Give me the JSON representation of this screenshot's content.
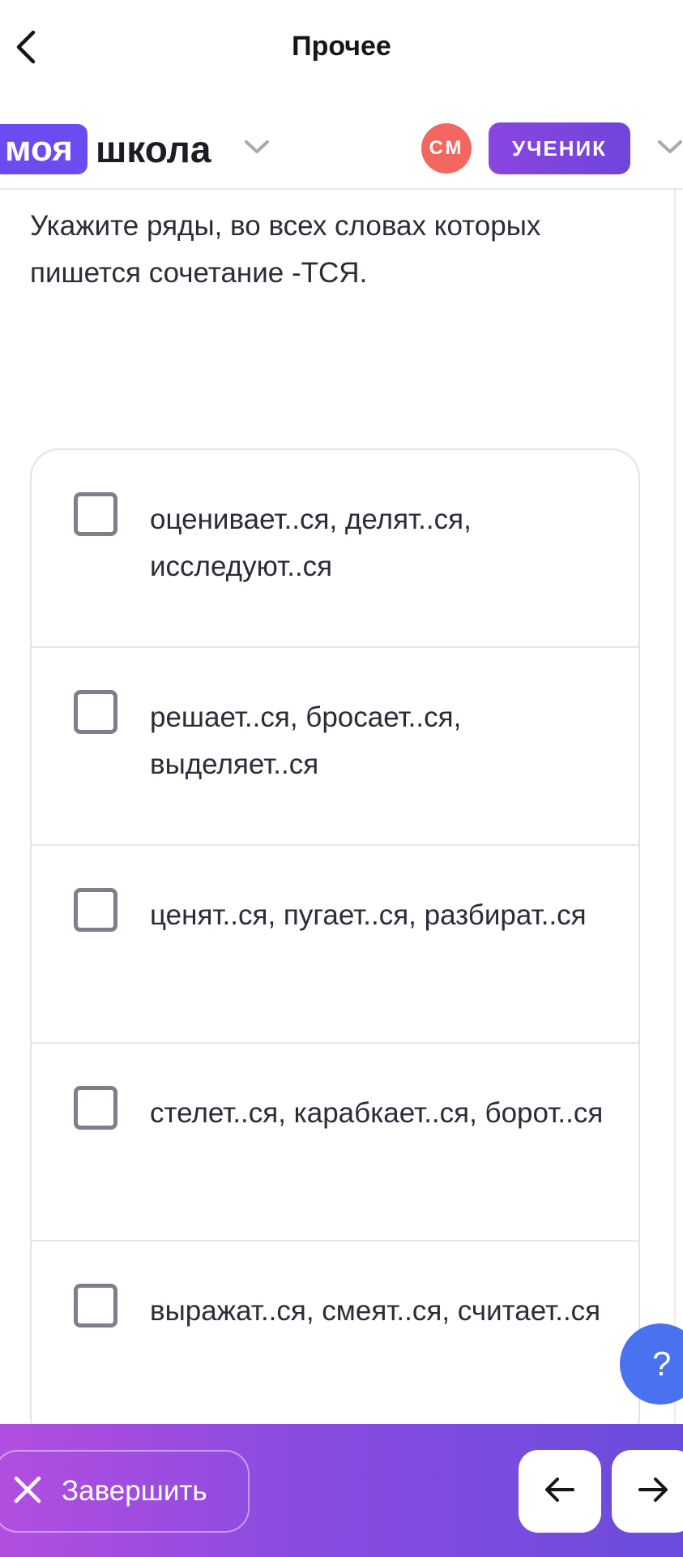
{
  "header": {
    "title": "Прочее",
    "back_icon": "chevron-left-icon"
  },
  "brand": {
    "logo_part1": "моя",
    "logo_part2": "школа",
    "avatar_initials": "СМ",
    "role_label": "УЧЕНИК"
  },
  "question": {
    "text": "Укажите ряды, во всех словах которых пишется сочетание -ТСЯ."
  },
  "options": [
    {
      "text": "оценивает..ся, делят..ся, исследуют..ся",
      "checked": false
    },
    {
      "text": "решает..ся, бросает..ся, выделяет..ся",
      "checked": false
    },
    {
      "text": "ценят..ся, пугает..ся, разбират..ся",
      "checked": false
    },
    {
      "text": "стелет..ся, карабкает..ся, борот..ся",
      "checked": false
    },
    {
      "text": "выражат..ся, смеят..ся, считает..ся",
      "checked": false
    }
  ],
  "help": {
    "label": "?"
  },
  "footer": {
    "finish_label": "Завершить",
    "prev_icon": "arrow-left-icon",
    "next_icon": "arrow-right-icon"
  },
  "colors": {
    "brand_purple": "#6a4cf0",
    "avatar_red": "#f2675f",
    "help_blue": "#4a72f0",
    "footer_gradient_start": "#b24ee0",
    "footer_gradient_end": "#6a4cdc"
  }
}
